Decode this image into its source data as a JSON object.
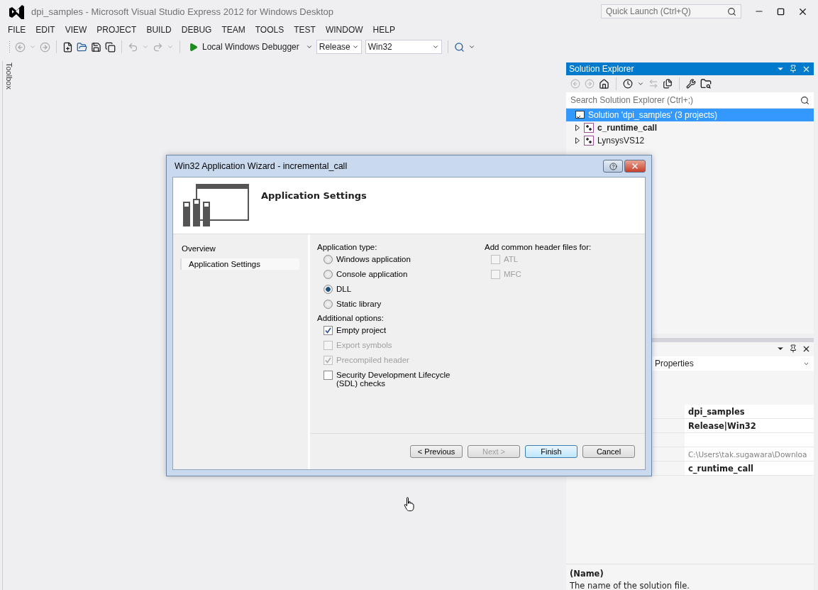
{
  "window": {
    "title": "dpi_samples - Microsoft Visual Studio Express 2012 for Windows Desktop"
  },
  "quick_launch": {
    "placeholder": "Quick Launch (Ctrl+Q)"
  },
  "menu": [
    "FILE",
    "EDIT",
    "VIEW",
    "PROJECT",
    "BUILD",
    "DEBUG",
    "TEAM",
    "TOOLS",
    "TEST",
    "WINDOW",
    "HELP"
  ],
  "toolbar": {
    "debugger": "Local Windows Debugger",
    "configuration": "Release",
    "platform": "Win32"
  },
  "toolbox": {
    "label": "Toolbox"
  },
  "solution_explorer": {
    "title": "Solution Explorer",
    "search": {
      "placeholder": "Search Solution Explorer (Ctrl+;)"
    },
    "items": [
      {
        "label": "Solution 'dpi_samples' (3 projects)",
        "kind": "solution",
        "selected": true,
        "bold": false
      },
      {
        "label": "c_runtime_call",
        "kind": "project",
        "selected": false,
        "bold": true,
        "expanded": false
      },
      {
        "label": "LynsysVS12",
        "kind": "project",
        "selected": false,
        "bold": false,
        "expanded": false
      }
    ]
  },
  "properties": {
    "object": "Properties",
    "rows": [
      {
        "value": "dpi_samples",
        "muted": false
      },
      {
        "value": "Release|Win32",
        "muted": false
      },
      {},
      {
        "value": "C:\\Users\\tak.sugawara\\Downloa",
        "muted": true
      },
      {
        "value": "c_runtime_call",
        "muted": false
      }
    ],
    "description": {
      "title": "(Name)",
      "text": "The name of the solution file."
    }
  },
  "dialog": {
    "title": "Win32 Application Wizard - incremental_call",
    "heading": "Application Settings",
    "nav": [
      {
        "label": "Overview",
        "selected": false
      },
      {
        "label": "Application Settings",
        "selected": true
      }
    ],
    "application_type": {
      "label": "Application type:",
      "options": [
        {
          "label": "Windows application",
          "selected": false
        },
        {
          "label": "Console application",
          "selected": false
        },
        {
          "label": "DLL",
          "selected": true
        },
        {
          "label": "Static library",
          "selected": false
        }
      ]
    },
    "additional_options": {
      "label": "Additional options:",
      "options": [
        {
          "label": "Empty project",
          "checked": true,
          "disabled": false
        },
        {
          "label": "Export symbols",
          "checked": false,
          "disabled": true
        },
        {
          "label": "Precompiled header",
          "checked": true,
          "disabled": true
        },
        {
          "label": "Security Development Lifecycle (SDL) checks",
          "checked": false,
          "disabled": false
        }
      ]
    },
    "header_files": {
      "label": "Add common header files for:",
      "options": [
        {
          "label": "ATL",
          "checked": false,
          "disabled": true
        },
        {
          "label": "MFC",
          "checked": false,
          "disabled": true
        }
      ]
    },
    "buttons": [
      {
        "label": "< Previous",
        "disabled": false,
        "default": false
      },
      {
        "label": "Next >",
        "disabled": true,
        "default": false
      },
      {
        "label": "Finish",
        "disabled": false,
        "default": true
      },
      {
        "label": "Cancel",
        "disabled": false,
        "default": false
      }
    ]
  }
}
